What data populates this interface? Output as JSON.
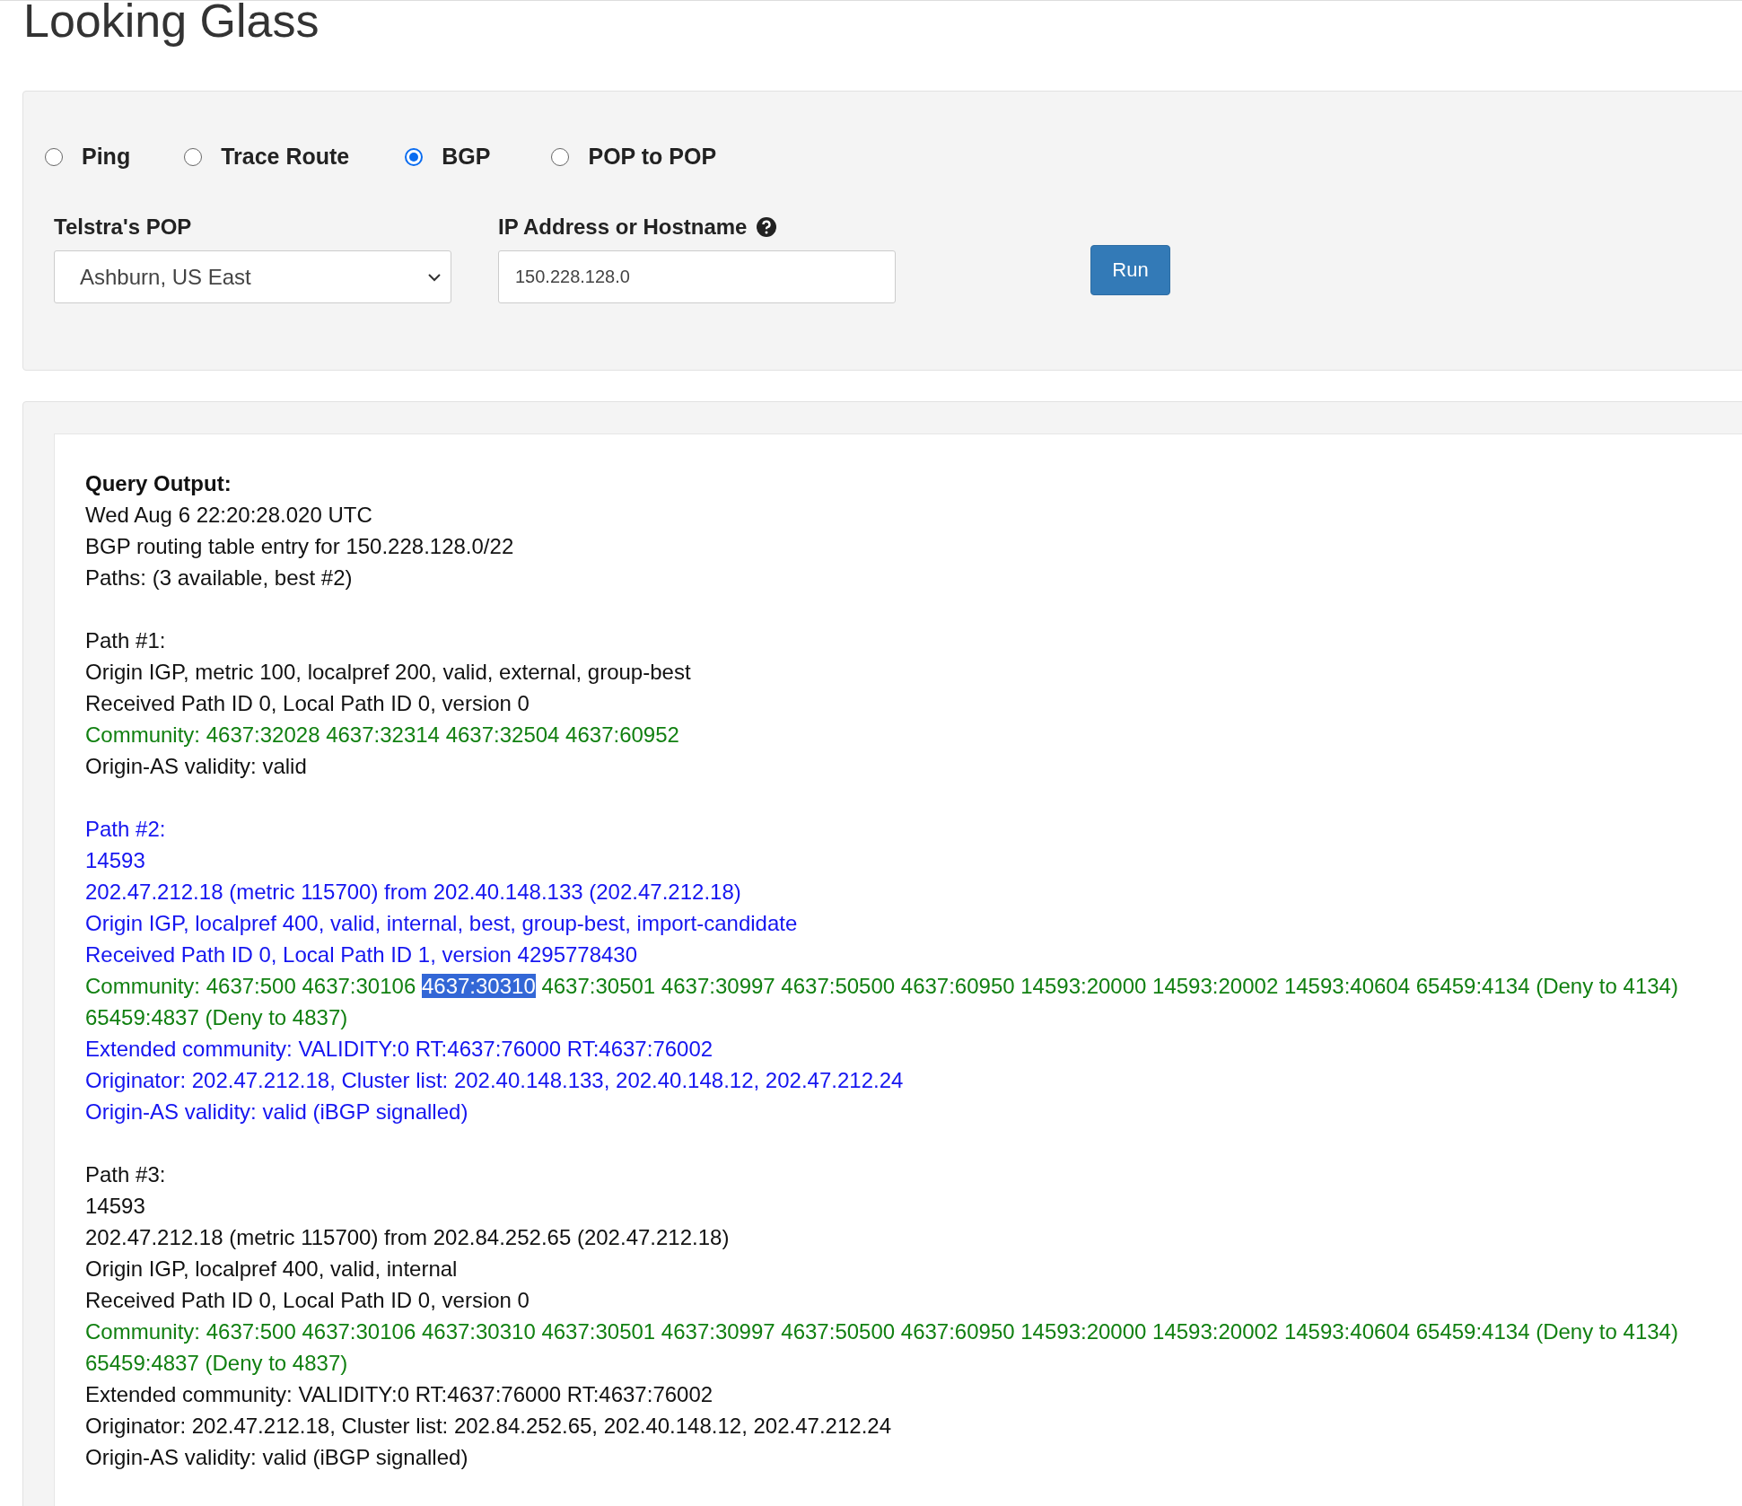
{
  "title": "Looking Glass",
  "query_types": [
    {
      "label": "Ping",
      "selected": false
    },
    {
      "label": "Trace Route",
      "selected": false
    },
    {
      "label": "BGP",
      "selected": true
    },
    {
      "label": "POP to POP",
      "selected": false
    }
  ],
  "pop": {
    "label": "Telstra's POP",
    "value": "Ashburn, US East"
  },
  "address": {
    "label": "IP Address or Hostname",
    "value": "150.228.128.0"
  },
  "run_button": "Run",
  "output": {
    "heading": "Query Output:",
    "blocks": [
      {
        "lines": [
          {
            "color": "#111111",
            "text": "Wed Aug 6 22:20:28.020 UTC"
          },
          {
            "color": "#111111",
            "text": "BGP routing table entry for 150.228.128.0/22"
          },
          {
            "color": "#111111",
            "text": "Paths: (3 available, best #2)"
          }
        ]
      },
      {
        "lines": [
          {
            "color": "#111111",
            "text": "Path #1:"
          },
          {
            "color": "#111111",
            "text": "Origin IGP, metric 100, localpref 200, valid, external, group-best"
          },
          {
            "color": "#111111",
            "text": "Received Path ID 0, Local Path ID 0, version 0"
          },
          {
            "color": "#118011",
            "text": "Community: 4637:32028 4637:32314 4637:32504 4637:60952"
          },
          {
            "color": "#111111",
            "text": "Origin-AS validity: valid"
          }
        ]
      },
      {
        "lines": [
          {
            "color": "#1515f0",
            "text": "Path #2:"
          },
          {
            "color": "#1515f0",
            "text": "14593"
          },
          {
            "color": "#1515f0",
            "text": "202.47.212.18 (metric 115700) from 202.40.148.133 (202.47.212.18)"
          },
          {
            "color": "#1515f0",
            "text": "Origin IGP, localpref 400, valid, internal, best, group-best, import-candidate"
          },
          {
            "color": "#1515f0",
            "text": "Received Path ID 0, Local Path ID 1, version 4295778430"
          },
          {
            "color": "#118011",
            "parts": [
              {
                "text": "Community: 4637:500 4637:30106",
                "selected": false
              },
              {
                "text": "4637:30310",
                "selected": true
              },
              {
                "text": "4637:30501 4637:30997 4637:50500 4637:60950 14593:20000 14593:20002 14593:40604 65459:4134 (Deny to 4134)",
                "selected": false
              }
            ]
          },
          {
            "color": "#118011",
            "text": "65459:4837 (Deny to 4837)"
          },
          {
            "color": "#1515f0",
            "text": "Extended community: VALIDITY:0 RT:4637:76000 RT:4637:76002"
          },
          {
            "color": "#1515f0",
            "text": "Originator: 202.47.212.18, Cluster list: 202.40.148.133, 202.40.148.12, 202.47.212.24"
          },
          {
            "color": "#1515f0",
            "text": "Origin-AS validity: valid (iBGP signalled)"
          }
        ]
      },
      {
        "lines": [
          {
            "color": "#111111",
            "text": "Path #3:"
          },
          {
            "color": "#111111",
            "text": "14593"
          },
          {
            "color": "#111111",
            "text": "202.47.212.18 (metric 115700) from 202.84.252.65 (202.47.212.18)"
          },
          {
            "color": "#111111",
            "text": "Origin IGP, localpref 400, valid, internal"
          },
          {
            "color": "#111111",
            "text": "Received Path ID 0, Local Path ID 0, version 0"
          },
          {
            "color": "#118011",
            "text": "Community: 4637:500 4637:30106 4637:30310 4637:30501 4637:30997 4637:50500 4637:60950 14593:20000 14593:20002 14593:40604 65459:4134 (Deny to 4134)"
          },
          {
            "color": "#118011",
            "text": "65459:4837 (Deny to 4837)"
          },
          {
            "color": "#111111",
            "text": "Extended community: VALIDITY:0 RT:4637:76000 RT:4637:76002"
          },
          {
            "color": "#111111",
            "text": "Originator: 202.47.212.18, Cluster list: 202.84.252.65, 202.40.148.12, 202.47.212.24"
          },
          {
            "color": "#111111",
            "text": "Origin-AS validity: valid (iBGP signalled)"
          }
        ]
      }
    ]
  }
}
